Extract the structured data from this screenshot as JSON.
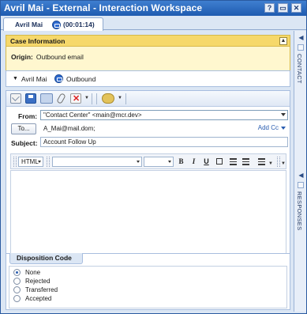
{
  "window": {
    "title": "Avril Mai - External - Interaction Workspace",
    "controls": [
      "?",
      "▭",
      "✕"
    ]
  },
  "tab": {
    "name": "Avril Mai",
    "timer": "(00:01:14)"
  },
  "case_info": {
    "title": "Case Information",
    "collapse_glyph": "▲",
    "origin_label": "Origin:",
    "origin_value": "Outbound email"
  },
  "party": {
    "name": "Avril Mai",
    "direction": "Outbound"
  },
  "email": {
    "from_label": "From:",
    "from_value": "\"Contact Center\" <main@mcr.dev>",
    "to_button": "To...",
    "to_value": "A_Mai@mail.dom;",
    "add_cc": "Add Cc",
    "subject_label": "Subject:",
    "subject_value": "Account Follow Up",
    "format": {
      "mode": "HTML",
      "font": "",
      "size": "",
      "bold": "B",
      "italic": "I",
      "underline": "U"
    }
  },
  "side_panel": {
    "contact_label": "CONTACT",
    "responses_label": "RESPONSES"
  },
  "disposition": {
    "title": "Disposition Code",
    "options": [
      {
        "label": "None",
        "checked": true
      },
      {
        "label": "Rejected",
        "checked": false
      },
      {
        "label": "Transferred",
        "checked": false
      },
      {
        "label": "Accepted",
        "checked": false
      }
    ]
  },
  "colors": {
    "title_bar": "#2a66c0",
    "case_header": "#f6d86a",
    "case_body": "#fff7cf",
    "panel_background": "#dbe6f4",
    "accent_link": "#2a5db0"
  }
}
